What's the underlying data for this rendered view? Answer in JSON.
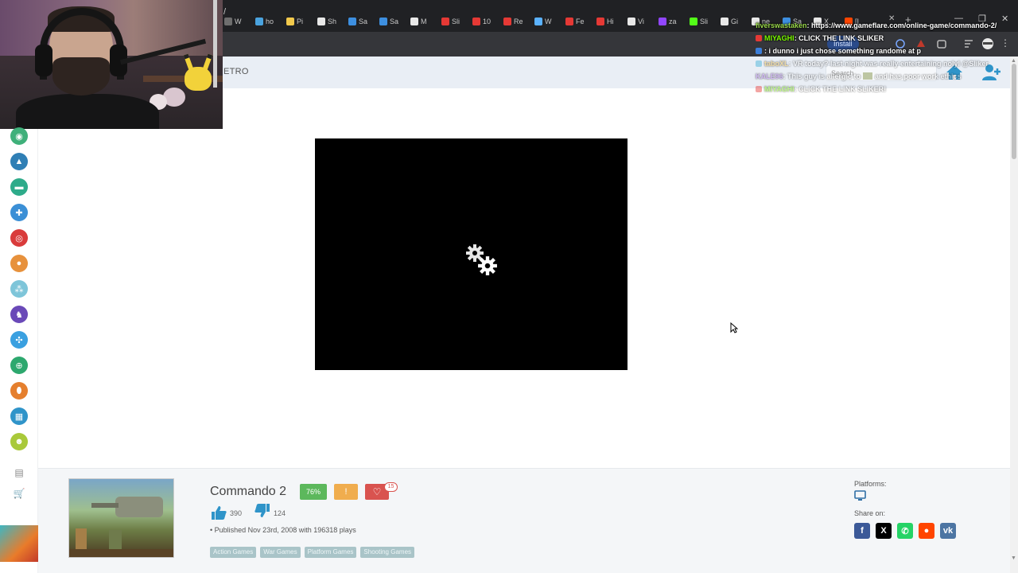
{
  "browser": {
    "tabs": [
      {
        "label": "W",
        "color": "#6e6e6e"
      },
      {
        "label": "ho",
        "color": "#4aa3df"
      },
      {
        "label": "Pi",
        "color": "#f2c94c"
      },
      {
        "label": "Sh",
        "color": "#e8e8e8"
      },
      {
        "label": "Sa",
        "color": "#3d8fe0"
      },
      {
        "label": "Sa",
        "color": "#3d8fe0"
      },
      {
        "label": "M",
        "color": "#e8e8e8"
      },
      {
        "label": "Sli",
        "color": "#e53935"
      },
      {
        "label": "10",
        "color": "#e53935"
      },
      {
        "label": "Re",
        "color": "#e53935"
      },
      {
        "label": "W",
        "color": "#5bb2ff"
      },
      {
        "label": "Fe",
        "color": "#e53935"
      },
      {
        "label": "Hi",
        "color": "#e53935"
      },
      {
        "label": "Vi",
        "color": "#e8e8e8"
      },
      {
        "label": "za",
        "color": "#9146ff"
      },
      {
        "label": "Sli",
        "color": "#53fc18"
      },
      {
        "label": "Gi",
        "color": "#e8e8e8"
      },
      {
        "label": "ne",
        "color": "#e8e8e8"
      },
      {
        "label": "Sa",
        "color": "#3d8fe0"
      },
      {
        "label": "X",
        "color": "#e8e8e8"
      },
      {
        "label": "[I",
        "color": "#ff4500"
      }
    ],
    "address_suffix": "/",
    "install_label": "Install"
  },
  "site_header": {
    "nav_partial": "ETRO",
    "search_placeholder": "Search"
  },
  "chat": [
    {
      "user": "fiverswastaken",
      "user_color": "#9ad94a",
      "text": ": https://www.gameflare.com/online-game/commando-2/",
      "badge": "",
      "faded": false
    },
    {
      "user": "MIYAGHI",
      "user_color": "#7cfc00",
      "text": ": CLICK THE LINK SLIKER",
      "badge": "#e53935",
      "faded": false
    },
    {
      "user": "",
      "user_color": "#ff4d4d",
      "text": ": i dunno i just chose something randome at p",
      "badge": "#3b7dd8",
      "faded": false
    },
    {
      "user": "taboXL",
      "user_color": "#f6c344",
      "text": ": VR today? last night was really entertaining nolyl @Sliker",
      "badge": "#3bb0d8",
      "faded": true
    },
    {
      "user": "KALE96",
      "user_color": "#b57cf2",
      "text": ": This guy is allergic to",
      "text2": "and has poor work ethics",
      "badge": "",
      "faded": true
    },
    {
      "user": "MIYAGHI",
      "user_color": "#7cfc00",
      "text": ": CLICK THE LINK SLIKER!",
      "badge": "#e53935",
      "faded": true
    }
  ],
  "sidebar": {
    "icons": [
      {
        "name": "sidebar-category-mask-icon",
        "color": "#3fb07a",
        "glyph": "◉"
      },
      {
        "name": "sidebar-category-rocket-icon",
        "color": "#2f7fb5",
        "glyph": "▲"
      },
      {
        "name": "sidebar-category-car-icon",
        "color": "#2eab8a",
        "glyph": "▬"
      },
      {
        "name": "sidebar-category-gamepad-icon",
        "color": "#3b8fd6",
        "glyph": "✚"
      },
      {
        "name": "sidebar-category-target-icon",
        "color": "#d93b3b",
        "glyph": "◎"
      },
      {
        "name": "sidebar-category-monkey-icon",
        "color": "#e7913c",
        "glyph": "●"
      },
      {
        "name": "sidebar-category-group-icon",
        "color": "#7ec5d9",
        "glyph": "⁂"
      },
      {
        "name": "sidebar-category-horse-icon",
        "color": "#6a49b8",
        "glyph": "♞"
      },
      {
        "name": "sidebar-category-puzzle-icon",
        "color": "#3aa0e0",
        "glyph": "✣"
      },
      {
        "name": "sidebar-category-crosshair-icon",
        "color": "#2da86e",
        "glyph": "⊕"
      },
      {
        "name": "sidebar-category-football-icon",
        "color": "#e57f2e",
        "glyph": "⬮"
      },
      {
        "name": "sidebar-category-building-icon",
        "color": "#2f94c9",
        "glyph": "▦"
      },
      {
        "name": "sidebar-category-zombie-icon",
        "color": "#a9c93a",
        "glyph": "☻"
      }
    ]
  },
  "game": {
    "title": "Commando 2",
    "rating": "76%",
    "warn_glyph": "!",
    "favorite_glyph": "♡",
    "favorite_count": "15",
    "likes": "390",
    "dislikes": "124",
    "published": "• Published Nov 23rd, 2008 with 196318 plays",
    "tags": [
      "Action Games",
      "War Games",
      "Platform Games",
      "Shooting Games"
    ],
    "platforms_label": "Platforms:",
    "share_label": "Share on:",
    "share": [
      {
        "name": "facebook-share-icon",
        "color": "#3b5998",
        "glyph": "f"
      },
      {
        "name": "x-share-icon",
        "color": "#000000",
        "glyph": "X"
      },
      {
        "name": "whatsapp-share-icon",
        "color": "#25d366",
        "glyph": "✆"
      },
      {
        "name": "reddit-share-icon",
        "color": "#ff4500",
        "glyph": "●"
      },
      {
        "name": "vk-share-icon",
        "color": "#4c75a3",
        "glyph": "vk"
      }
    ]
  },
  "colors": {
    "accent_blue": "#2f94c9",
    "rating_green": "#5cb85c",
    "warn_orange": "#f0ad4e",
    "fav_red": "#d9534f",
    "tag_bg": "#a9c4c8"
  }
}
